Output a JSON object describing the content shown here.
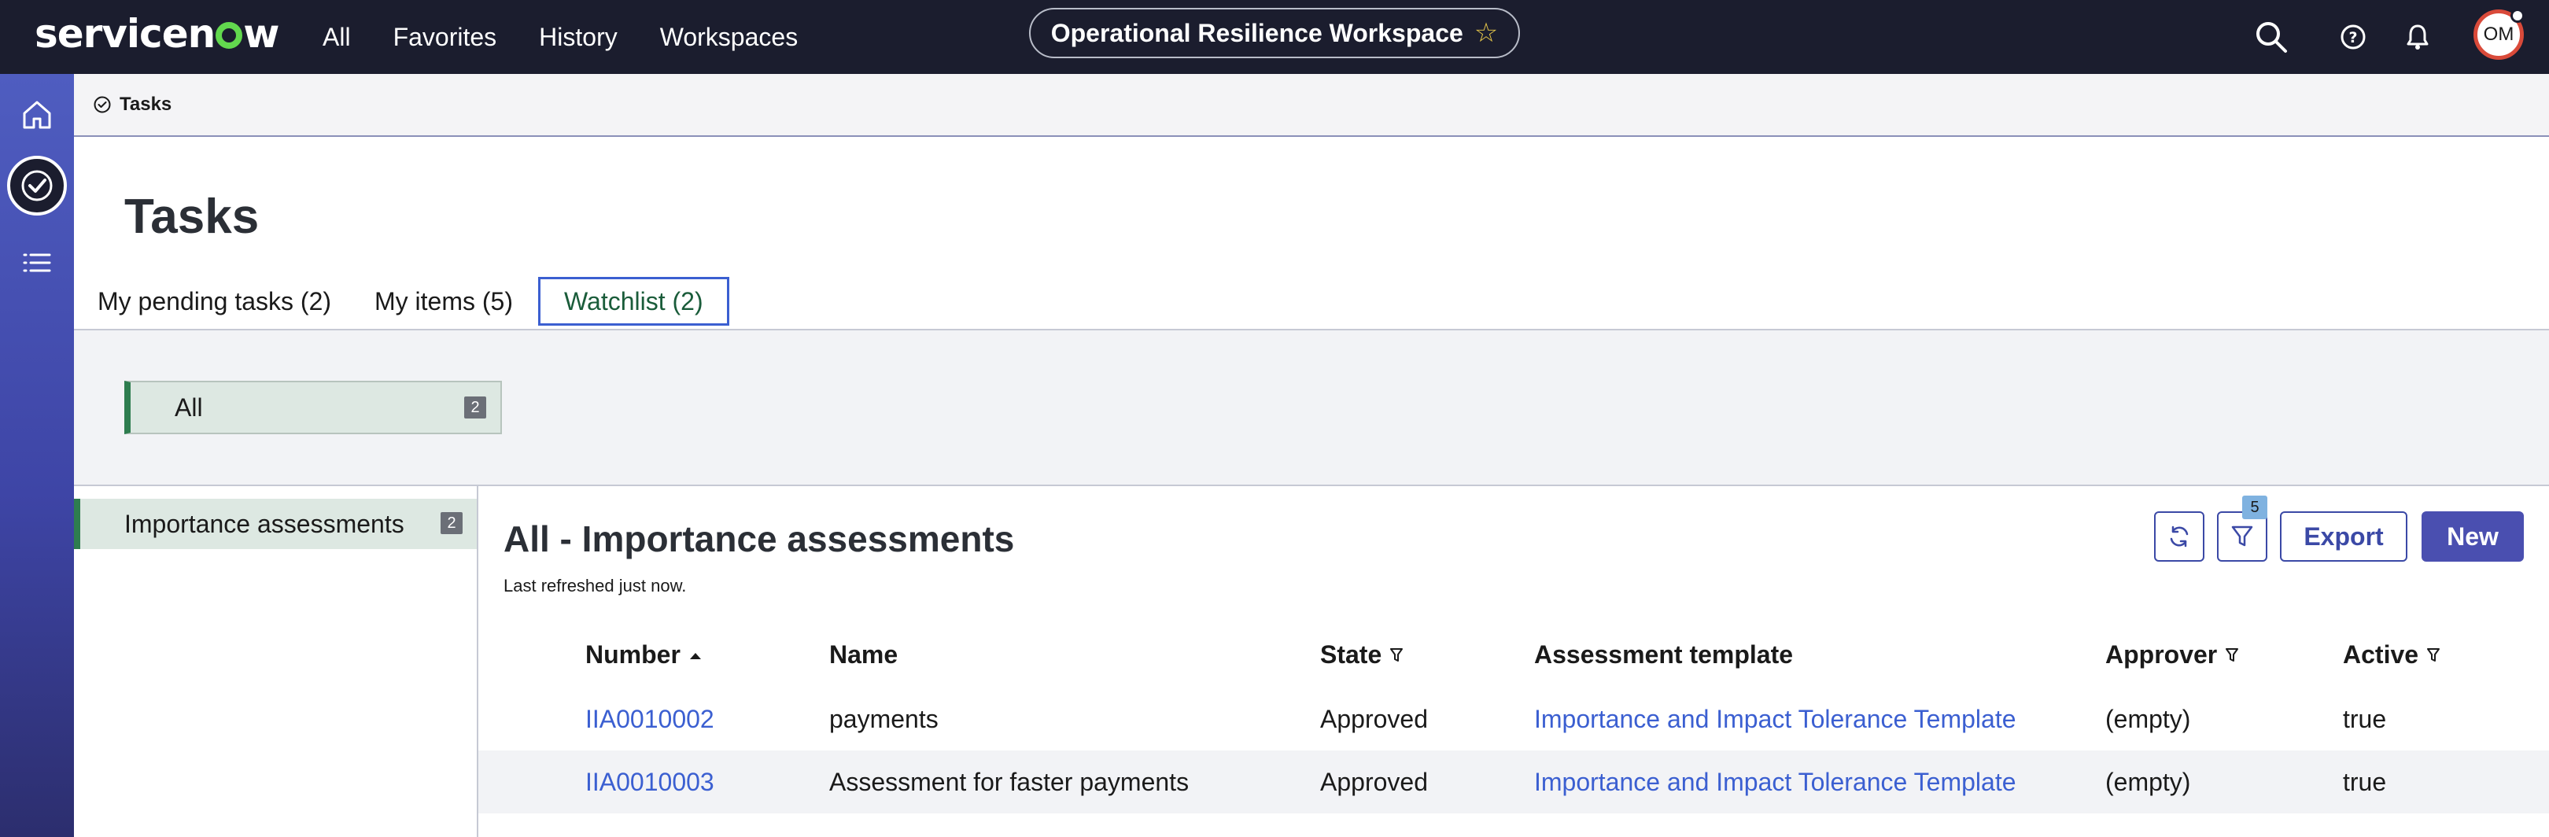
{
  "topbar": {
    "brand": "servicenow",
    "nav": [
      "All",
      "Favorites",
      "History",
      "Workspaces"
    ],
    "workspace_title": "Operational Resilience Workspace",
    "avatar_initials": "OM"
  },
  "breadcrumb": {
    "label": "Tasks"
  },
  "page": {
    "title": "Tasks"
  },
  "tabs": [
    {
      "label": "My pending tasks (2)"
    },
    {
      "label": "My items (5)"
    },
    {
      "label": "Watchlist (2)"
    }
  ],
  "filter": {
    "all_label": "All",
    "all_count": "2"
  },
  "left_list": {
    "item_label": "Importance assessments",
    "item_count": "2"
  },
  "list": {
    "title": "All - Importance assessments",
    "refreshed": "Last refreshed just now.",
    "filter_badge": "5",
    "export_label": "Export",
    "new_label": "New",
    "columns": {
      "number": "Number",
      "name": "Name",
      "state": "State",
      "template": "Assessment template",
      "approver": "Approver",
      "active": "Active"
    },
    "rows": [
      {
        "number": "IIA0010002",
        "name": "payments",
        "state": "Approved",
        "template": "Importance and Impact Tolerance Template",
        "approver": "(empty)",
        "active": "true"
      },
      {
        "number": "IIA0010003",
        "name": "Assessment for faster payments",
        "state": "Approved",
        "template": "Importance and Impact Tolerance Template",
        "approver": "(empty)",
        "active": "true"
      }
    ]
  },
  "colors": {
    "topbar_bg": "#1b1d2e",
    "rail_gradient_start": "#4f5dc0",
    "accent_blue": "#3b49a6",
    "link_blue": "#3b5fd1",
    "selection_green": "#2e7d4f",
    "logo_green": "#62d84e"
  }
}
